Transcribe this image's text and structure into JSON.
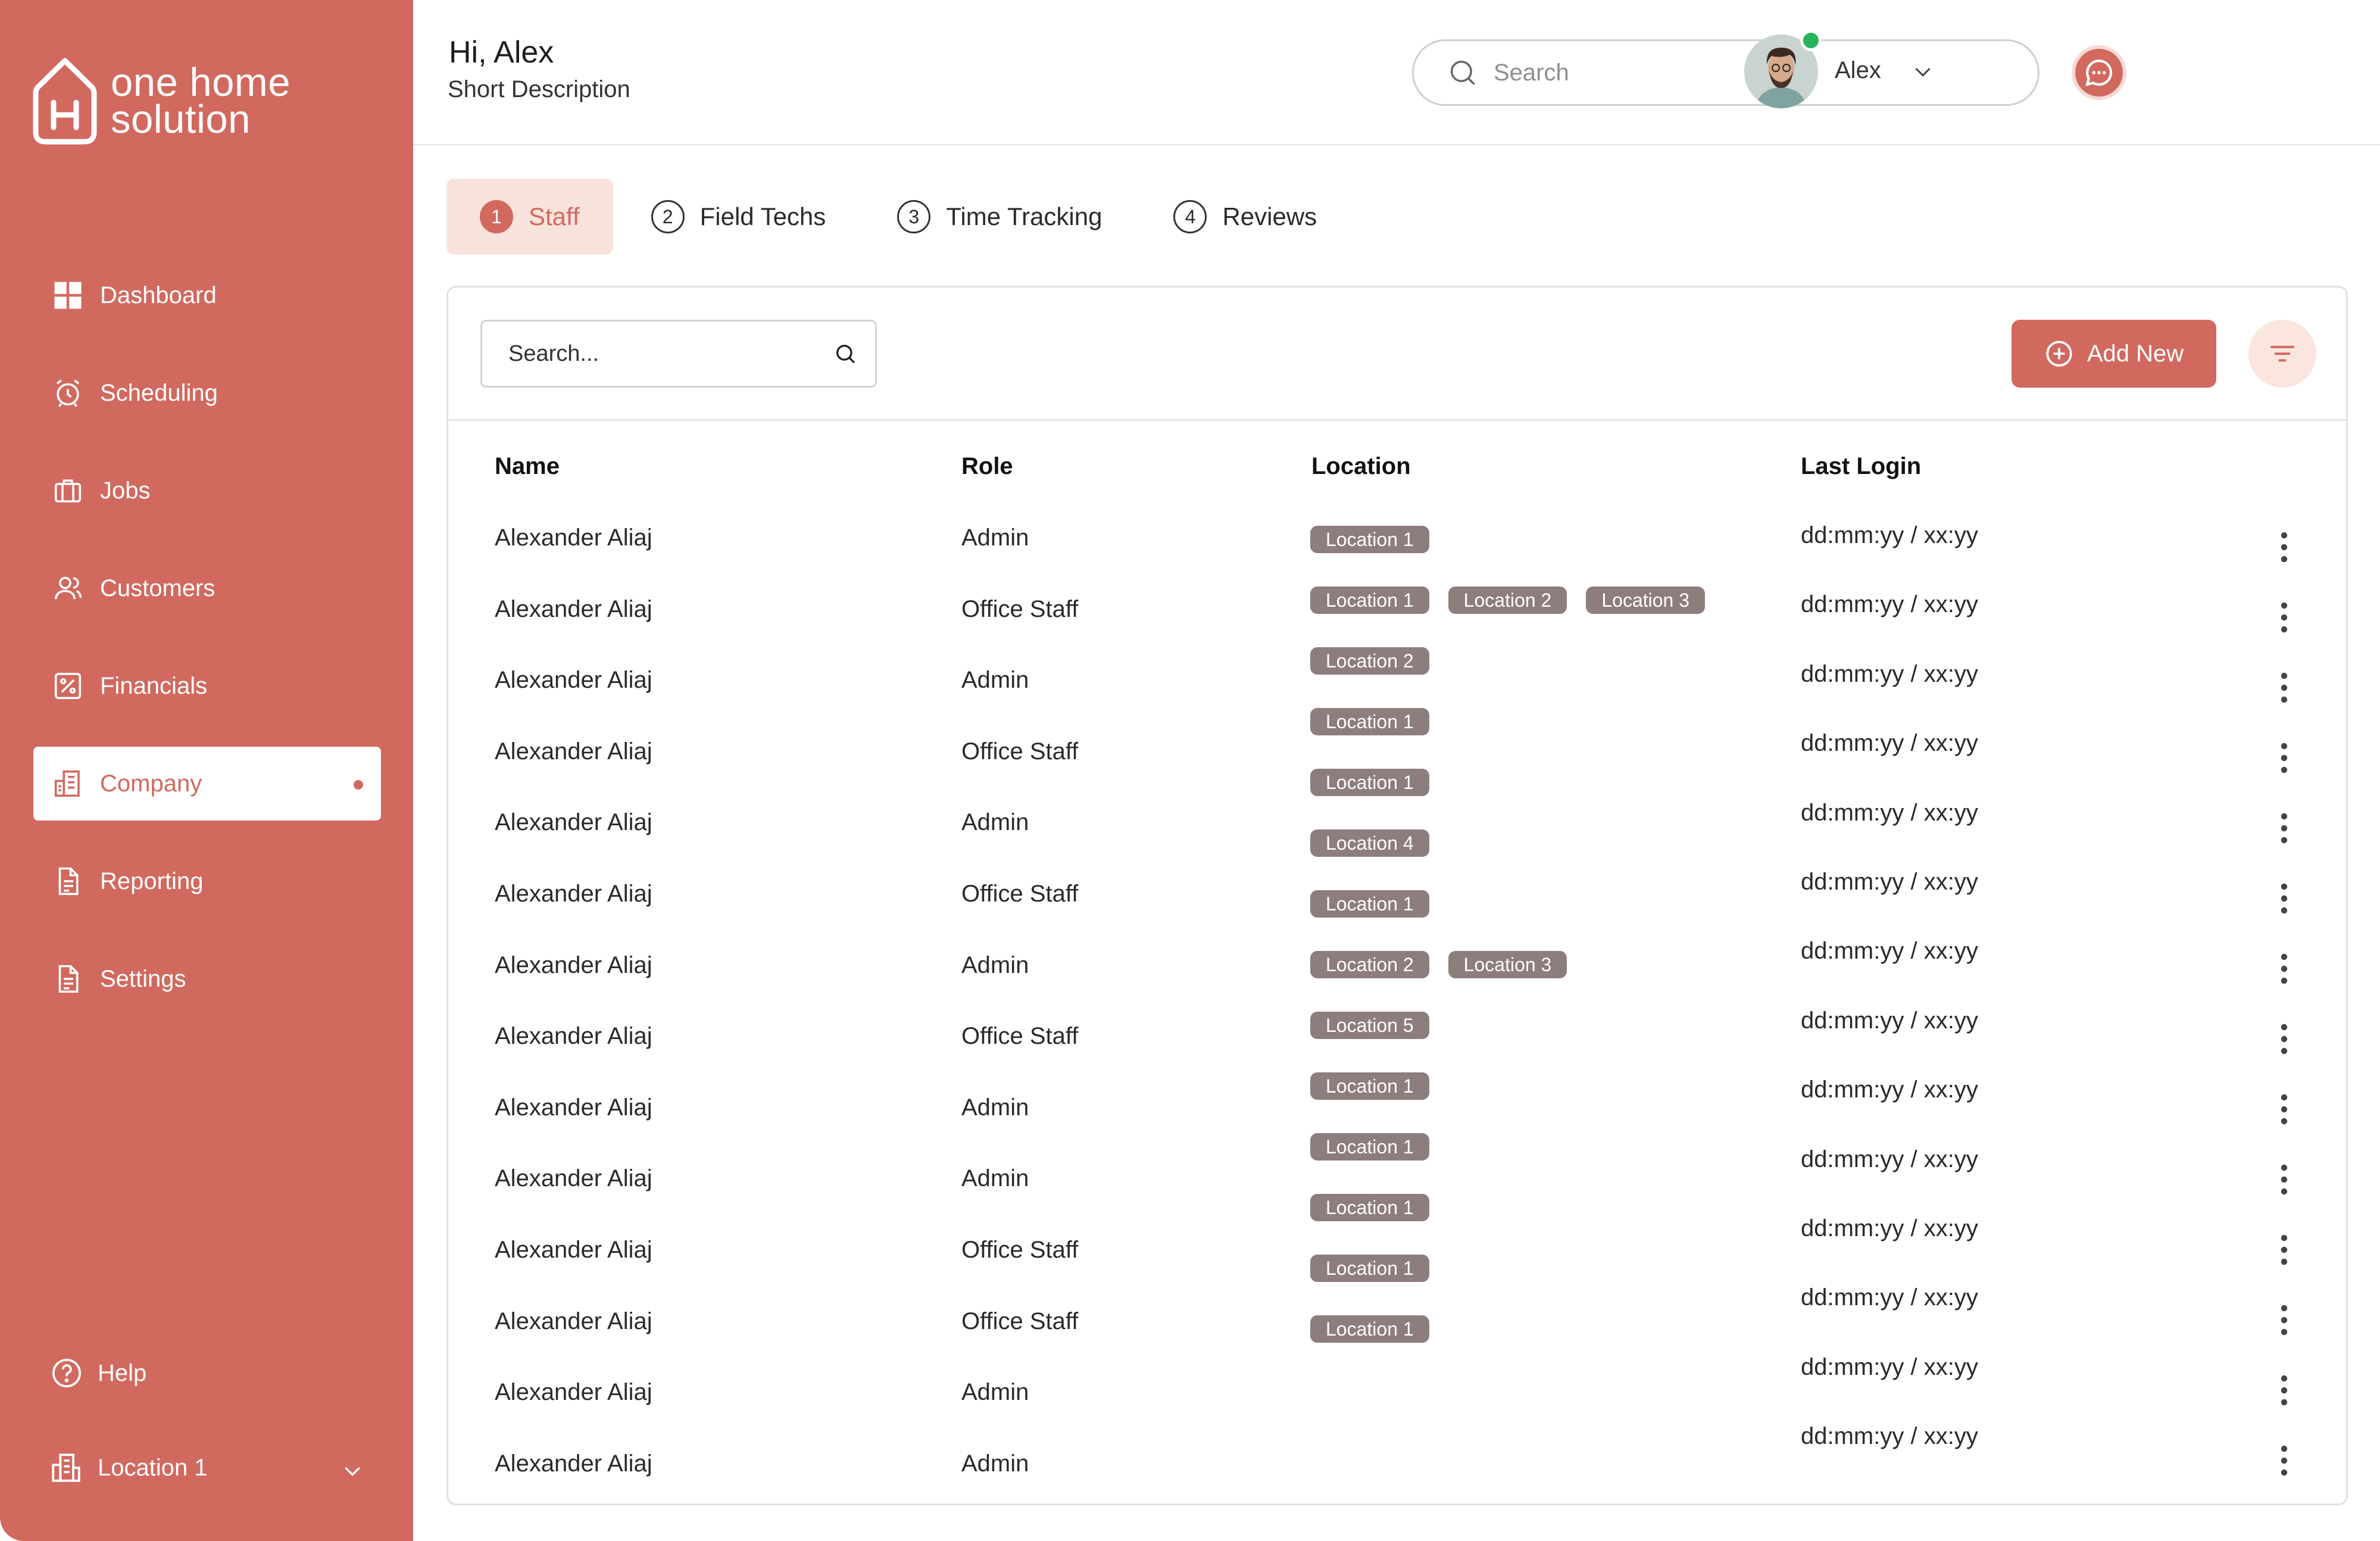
{
  "brand": {
    "line1": "one home",
    "line2": "solution"
  },
  "sidebar": {
    "items": [
      {
        "label": "Dashboard",
        "icon": "grid-icon"
      },
      {
        "label": "Scheduling",
        "icon": "alarm-clock-icon"
      },
      {
        "label": "Jobs",
        "icon": "briefcase-icon"
      },
      {
        "label": "Customers",
        "icon": "users-icon"
      },
      {
        "label": "Financials",
        "icon": "percent-icon"
      },
      {
        "label": "Company",
        "icon": "building-icon",
        "active": true
      },
      {
        "label": "Reporting",
        "icon": "document-icon"
      },
      {
        "label": "Settings",
        "icon": "document-icon"
      }
    ],
    "help_label": "Help",
    "location_label": "Location 1"
  },
  "header": {
    "greeting": "Hi, Alex",
    "subtitle": "Short Description",
    "search_placeholder": "Search",
    "user_name": "Alex"
  },
  "tabs": [
    {
      "num": "1",
      "label": "Staff",
      "active": true
    },
    {
      "num": "2",
      "label": "Field Techs"
    },
    {
      "num": "3",
      "label": "Time Tracking"
    },
    {
      "num": "4",
      "label": "Reviews"
    }
  ],
  "table": {
    "search_placeholder": "Search...",
    "add_label": "Add New",
    "headers": {
      "name": "Name",
      "role": "Role",
      "location": "Location",
      "last_login": "Last Login"
    },
    "rows": [
      {
        "name": "Alexander Aliaj",
        "role": "Admin",
        "locations": [
          "Location 1"
        ],
        "last_login": "dd:mm:yy / xx:yy"
      },
      {
        "name": "Alexander Aliaj",
        "role": "Office Staff",
        "locations": [
          "Location 1",
          "Location 2",
          "Location 3"
        ],
        "last_login": "dd:mm:yy / xx:yy"
      },
      {
        "name": "Alexander Aliaj",
        "role": "Admin",
        "locations": [
          "Location 2"
        ],
        "last_login": "dd:mm:yy / xx:yy"
      },
      {
        "name": "Alexander Aliaj",
        "role": "Office Staff",
        "locations": [
          "Location 1"
        ],
        "last_login": "dd:mm:yy / xx:yy"
      },
      {
        "name": "Alexander Aliaj",
        "role": "Admin",
        "locations": [
          "Location 1"
        ],
        "last_login": "dd:mm:yy / xx:yy"
      },
      {
        "name": "Alexander Aliaj",
        "role": "Office Staff",
        "locations": [
          "Location 4"
        ],
        "last_login": "dd:mm:yy / xx:yy"
      },
      {
        "name": "Alexander Aliaj",
        "role": "Admin",
        "locations": [
          "Location 1"
        ],
        "last_login": "dd:mm:yy / xx:yy"
      },
      {
        "name": "Alexander Aliaj",
        "role": "Office Staff",
        "locations": [
          "Location 2",
          "Location 3"
        ],
        "last_login": "dd:mm:yy / xx:yy"
      },
      {
        "name": "Alexander Aliaj",
        "role": "Admin",
        "locations": [
          "Location 5"
        ],
        "last_login": "dd:mm:yy / xx:yy"
      },
      {
        "name": "Alexander Aliaj",
        "role": "Admin",
        "locations": [
          "Location 1"
        ],
        "last_login": "dd:mm:yy / xx:yy"
      },
      {
        "name": "Alexander Aliaj",
        "role": "Office Staff",
        "locations": [
          "Location 1"
        ],
        "last_login": "dd:mm:yy / xx:yy"
      },
      {
        "name": "Alexander Aliaj",
        "role": "Office Staff",
        "locations": [
          "Location 1"
        ],
        "last_login": "dd:mm:yy / xx:yy"
      },
      {
        "name": "Alexander Aliaj",
        "role": "Admin",
        "locations": [
          "Location 1"
        ],
        "last_login": "dd:mm:yy / xx:yy"
      },
      {
        "name": "Alexander Aliaj",
        "role": "Admin",
        "locations": [
          "Location 1"
        ],
        "last_login": "dd:mm:yy / xx:yy"
      }
    ]
  },
  "colors": {
    "brand": "#D1695F",
    "chip": "#8E7D7D",
    "tab_active_bg": "#F8E3DC",
    "online": "#25b45a"
  }
}
